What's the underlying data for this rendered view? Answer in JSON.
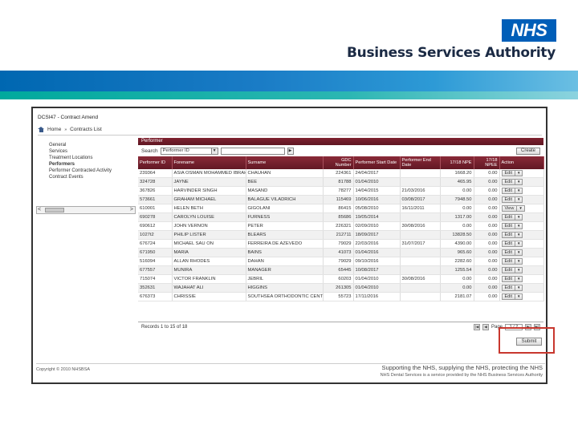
{
  "header": {
    "logo_text": "NHS",
    "org_name": "Business Services Authority"
  },
  "app": {
    "title": "DCSI47 - Contract Amend",
    "breadcrumb": [
      "Home",
      "Contracts List"
    ],
    "crumb_separator": "»"
  },
  "nav": {
    "items": [
      {
        "label": "General",
        "active": false
      },
      {
        "label": "Services",
        "active": false
      },
      {
        "label": "Treatment Locations",
        "active": false
      },
      {
        "label": "Performers",
        "active": true
      },
      {
        "label": "Performer Contracted Activity",
        "active": false
      },
      {
        "label": "Contract Events",
        "active": false
      }
    ],
    "scroll_left": "<",
    "scroll_right": ">"
  },
  "panel": {
    "title": "Performer",
    "search_label": "Search",
    "search_field": "Performer ID",
    "search_value": "",
    "create_label": "Create",
    "columns": [
      "Performer ID",
      "Forename",
      "Surname",
      "GDC Number",
      "Performer Start Date",
      "Performer End Date",
      "17/18 NPE",
      "17/18 NPEE",
      "Action"
    ],
    "rows": [
      {
        "id": "239364",
        "forename": "ASIA OSMAN MOHAMMED IBRAHIM",
        "surname": "CHAUHAN",
        "gdc": "224361",
        "start": "24/04/2017",
        "end": "",
        "npe": "1668.20",
        "npee": "0.00",
        "action": "Edit"
      },
      {
        "id": "324728",
        "forename": "JAYNE",
        "surname": "BEE",
        "gdc": "81788",
        "start": "01/04/2010",
        "end": "",
        "npe": "465.95",
        "npee": "0.00",
        "action": "Edit"
      },
      {
        "id": "367826",
        "forename": "HARVINDER SINGH",
        "surname": "MASAND",
        "gdc": "78277",
        "start": "14/04/2015",
        "end": "21/03/2016",
        "npe": "0.00",
        "npee": "0.00",
        "action": "Edit"
      },
      {
        "id": "573661",
        "forename": "GRAHAM MICHAEL",
        "surname": "BALAGUE VILADRICH",
        "gdc": "115469",
        "start": "10/06/2016",
        "end": "03/08/2017",
        "npe": "7948.50",
        "npee": "0.00",
        "action": "Edit"
      },
      {
        "id": "610001",
        "forename": "HELEN BETH",
        "surname": "GIGOLANI",
        "gdc": "86415",
        "start": "05/08/2010",
        "end": "16/11/2011",
        "npe": "0.00",
        "npee": "0.00",
        "action": "View"
      },
      {
        "id": "690278",
        "forename": "CAROLYN LOUISE",
        "surname": "FURNESS",
        "gdc": "85686",
        "start": "19/05/2014",
        "end": "",
        "npe": "1317.00",
        "npee": "0.00",
        "action": "Edit"
      },
      {
        "id": "690612",
        "forename": "JOHN VERNON",
        "surname": "PETER",
        "gdc": "226321",
        "start": "02/09/2010",
        "end": "30/08/2016",
        "npe": "0.00",
        "npee": "0.00",
        "action": "Edit"
      },
      {
        "id": "1027t2",
        "forename": "PHILIP LISTER",
        "surname": "BLEARS",
        "gdc": "212711",
        "start": "18/09/2017",
        "end": "",
        "npe": "13828.50",
        "npee": "0.00",
        "action": "Edit"
      },
      {
        "id": "676724",
        "forename": "MICHAEL SAU ON",
        "surname": "FERREIRA DE AZEVEDO",
        "gdc": "79029",
        "start": "22/03/2016",
        "end": "31/07/2017",
        "npe": "4390.00",
        "npee": "0.00",
        "action": "Edit"
      },
      {
        "id": "671950",
        "forename": "MARIA",
        "surname": "BAINS",
        "gdc": "41073",
        "start": "01/04/2016",
        "end": "",
        "npe": "965.60",
        "npee": "0.00",
        "action": "Edit"
      },
      {
        "id": "516094",
        "forename": "ALLAN RHODES",
        "surname": "DAHAN",
        "gdc": "79029",
        "start": "09/10/2016",
        "end": "",
        "npe": "2282.60",
        "npee": "0.00",
        "action": "Edit"
      },
      {
        "id": "677557",
        "forename": "MUNIRA",
        "surname": "MANAGER",
        "gdc": "65445",
        "start": "10/08/2017",
        "end": "",
        "npe": "1255.54",
        "npee": "0.00",
        "action": "Edit"
      },
      {
        "id": "715074",
        "forename": "VICTOR FRANKLIN",
        "surname": "JEBRIL",
        "gdc": "60203",
        "start": "01/04/2010",
        "end": "30/08/2016",
        "npe": "0.00",
        "npee": "0.00",
        "action": "Edit"
      },
      {
        "id": "352631",
        "forename": "WAJAHAT ALI",
        "surname": "HIGGINS",
        "gdc": "261305",
        "start": "01/04/2010",
        "end": "",
        "npe": "0.00",
        "npee": "0.00",
        "action": "Edit"
      },
      {
        "id": "676373",
        "forename": "CHRISSIE",
        "surname": "SOUTHSEA ORTHODONTIC CENTRE",
        "gdc": "55723",
        "start": "17/11/2016",
        "end": "",
        "npe": "2181.07",
        "npee": "0.00",
        "action": "Edit"
      }
    ],
    "records_text": "Records 1 to 15 of 18",
    "page_label": "Page",
    "page_value": "1 / 2"
  },
  "submit_label": "Submit",
  "footer": {
    "copyright": "Copyright © 2010 NHSBSA",
    "tagline": "Supporting the NHS, supplying the NHS, protecting the NHS",
    "subline": "NHS Dental Services is a service provided by the NHS Business Services Authority"
  },
  "colors": {
    "nhs_blue": "#005eb8",
    "panel_header": "#7f2230",
    "highlight": "#c8372e"
  }
}
